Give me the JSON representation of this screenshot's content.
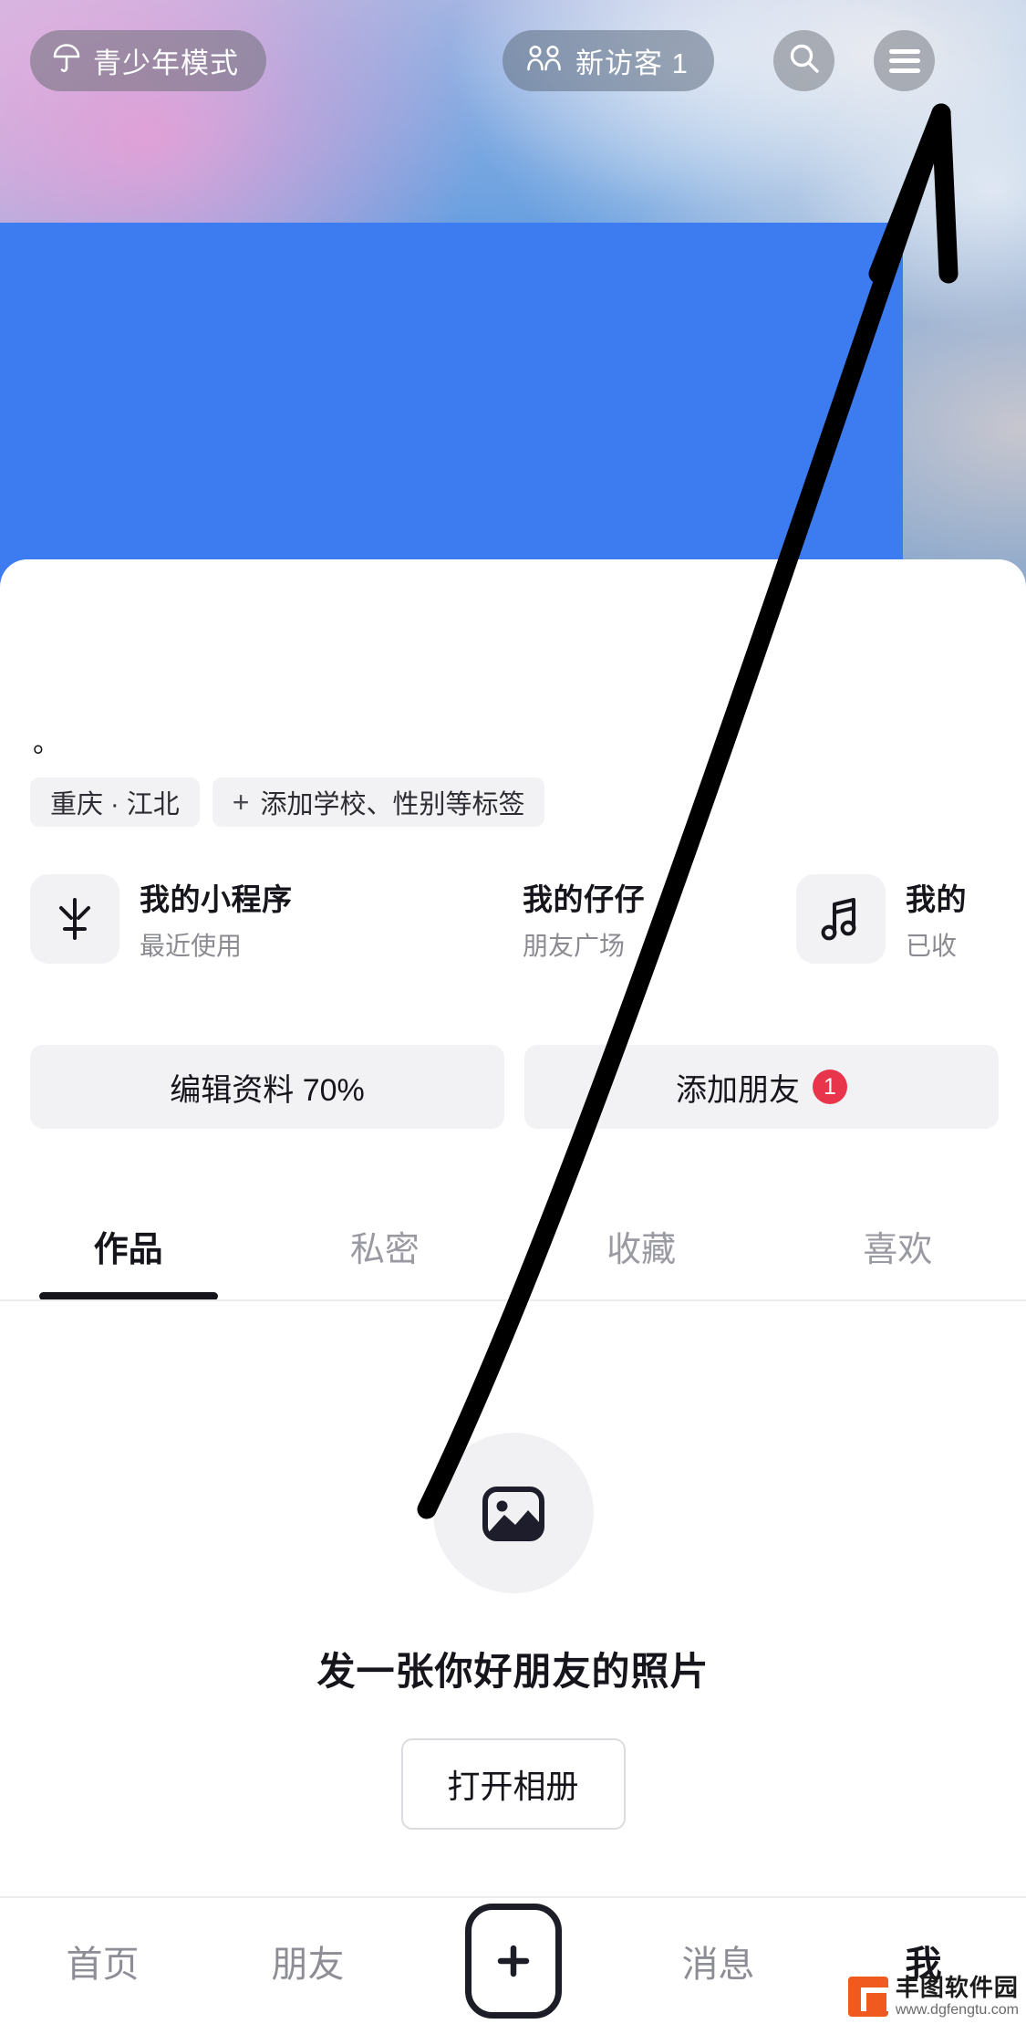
{
  "topbar": {
    "teen_mode_label": "青少年模式",
    "teen_mode_icon": "umbrella-icon",
    "visitor_label": "新访客 1",
    "visitor_icon": "people-icon",
    "search_icon": "search-icon",
    "menu_icon": "hamburger-menu-icon"
  },
  "profile": {
    "nickname_fragment": "。",
    "chips": [
      {
        "label": "重庆 · 江北",
        "has_plus": false
      },
      {
        "label": "添加学校、性别等标签",
        "has_plus": true,
        "plus": "+"
      }
    ]
  },
  "entries": [
    {
      "title": "我的小程序",
      "subtitle": "最近使用",
      "icon": "mini-program-icon"
    },
    {
      "title": "我的仔仔",
      "subtitle": "朋友广场",
      "icon": "friends-plaza-icon"
    },
    {
      "title": "我的",
      "subtitle": "已收",
      "icon": "music-note-icon"
    }
  ],
  "actions": {
    "edit_profile_label": "编辑资料 70%",
    "add_friend_label": "添加朋友",
    "add_friend_badge": "1",
    "badge_color": "#e8354c"
  },
  "tabs": [
    {
      "label": "作品",
      "active": true
    },
    {
      "label": "私密",
      "active": false
    },
    {
      "label": "收藏",
      "active": false
    },
    {
      "label": "喜欢",
      "active": false
    }
  ],
  "empty_state": {
    "icon": "image-placeholder-icon",
    "message": "发一张你好朋友的照片",
    "button_label": "打开相册"
  },
  "bottom_nav": [
    {
      "label": "首页",
      "active": false
    },
    {
      "label": "朋友",
      "active": false
    },
    {
      "label": "+",
      "active": false,
      "is_plus": true
    },
    {
      "label": "消息",
      "active": false
    },
    {
      "label": "我",
      "active": true
    }
  ],
  "annotation": {
    "arrow_color": "#000000",
    "points_to": "hamburger-menu-icon"
  },
  "watermark": {
    "name": "丰图软件园",
    "url": "www.dgfengtu.com"
  },
  "colors": {
    "redaction_blue": "#3c7cf0",
    "accent_dark": "#15151b",
    "chip_bg": "#f2f2f4"
  }
}
